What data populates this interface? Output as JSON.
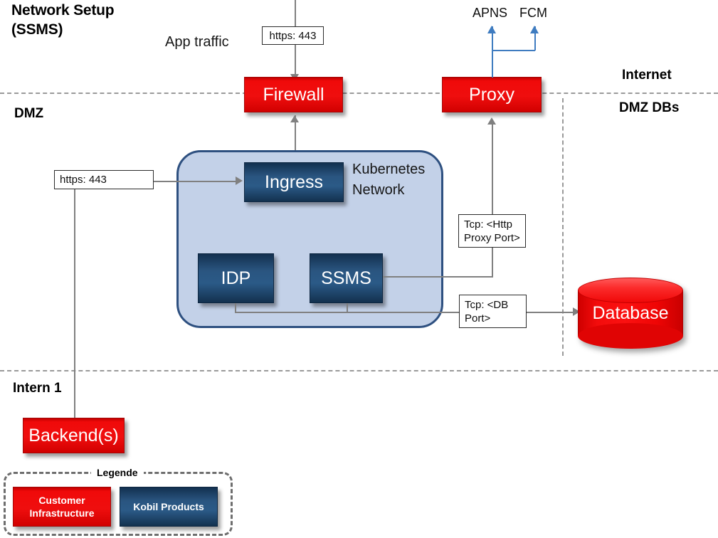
{
  "diagram": {
    "title_line1": "Network Setup",
    "title_line2": "(SSMS)"
  },
  "zones": {
    "internet": "Internet",
    "dmz": "DMZ",
    "dmz_dbs": "DMZ DBs",
    "intern": "Intern 1"
  },
  "labels": {
    "app_traffic": "App traffic",
    "kubernetes_line1": "Kubernetes",
    "kubernetes_line2": "Network",
    "apns": "APNS",
    "fcm": "FCM"
  },
  "nodes": {
    "firewall": "Firewall",
    "proxy": "Proxy",
    "ingress": "Ingress",
    "idp": "IDP",
    "ssms": "SSMS",
    "database": "Database",
    "backends": "Backend(s)"
  },
  "connectors": {
    "https_top": "https: 443",
    "https_left": "https: 443",
    "tcp_http_proxy_line1": "Tcp: <Http",
    "tcp_http_proxy_line2": "Proxy Port>",
    "tcp_db_line1": "Tcp: <DB",
    "tcp_db_line2": "Port>"
  },
  "legend": {
    "title": "Legende",
    "customer_line1": "Customer",
    "customer_line2": "Infrastructure",
    "kobil": "Kobil Products"
  },
  "colors": {
    "customer_red": "#ef0e0e",
    "kobil_blue": "#2a5580",
    "k8s_fill": "#c3d1e8",
    "k8s_border": "#2e5080",
    "connector_gray": "#808080",
    "connector_blue": "#3f7cc0",
    "zone_dash": "#9a9a9a"
  }
}
